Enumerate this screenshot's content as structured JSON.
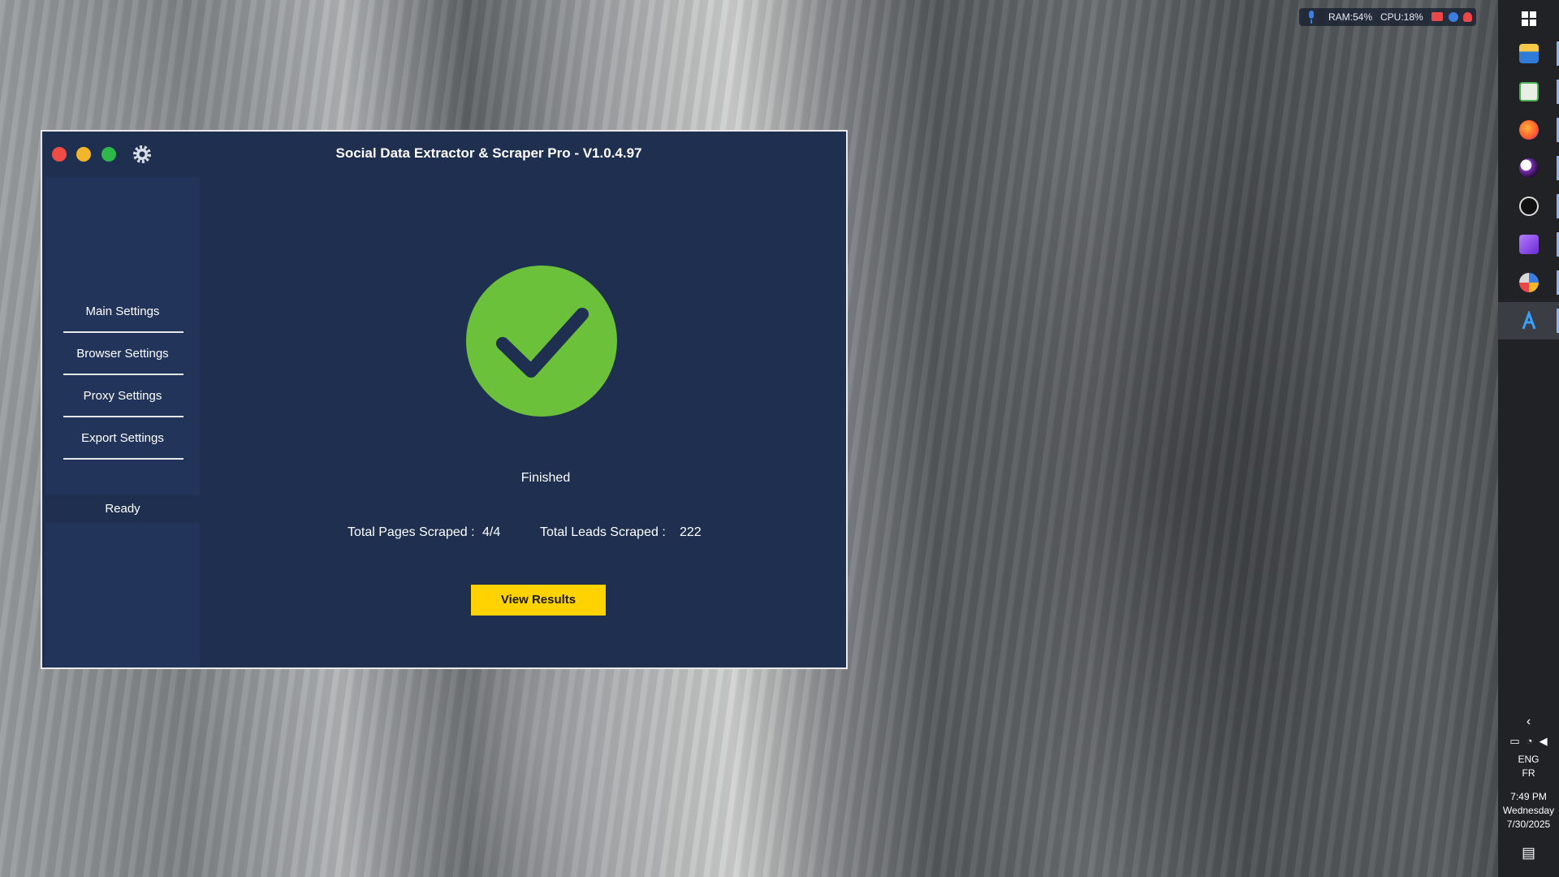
{
  "app": {
    "title": "Social Data Extractor & Scraper  Pro - V1.0.4.97",
    "sidebar": {
      "items": [
        {
          "label": "Main Settings"
        },
        {
          "label": "Browser Settings"
        },
        {
          "label": "Proxy Settings"
        },
        {
          "label": "Export Settings"
        }
      ],
      "status": "Ready"
    },
    "main": {
      "status_text": "Finished",
      "total_pages_label": "Total Pages Scraped :",
      "total_pages_value": "4/4",
      "total_leads_label": "Total Leads Scraped :",
      "total_leads_value": "222",
      "view_results_label": "View Results"
    },
    "colors": {
      "window_bg": "#1e2f4f",
      "sidebar_bg": "#22345a",
      "success_green": "#6cc13a",
      "button_yellow": "#ffd200"
    }
  },
  "system_monitor": {
    "ram": "RAM:54%",
    "cpu": "CPU:18%"
  },
  "taskbar": {
    "icons": [
      "windows-start-icon",
      "file-explorer-icon",
      "spreadsheet-icon",
      "firefox-icon",
      "app-icon-circle",
      "obs-icon",
      "visual-studio-icon",
      "paint-icon",
      "scraper-app-icon"
    ],
    "language": "ENG",
    "locale": "FR",
    "time": "7:49 PM",
    "day": "Wednesday",
    "date": "7/30/2025"
  }
}
